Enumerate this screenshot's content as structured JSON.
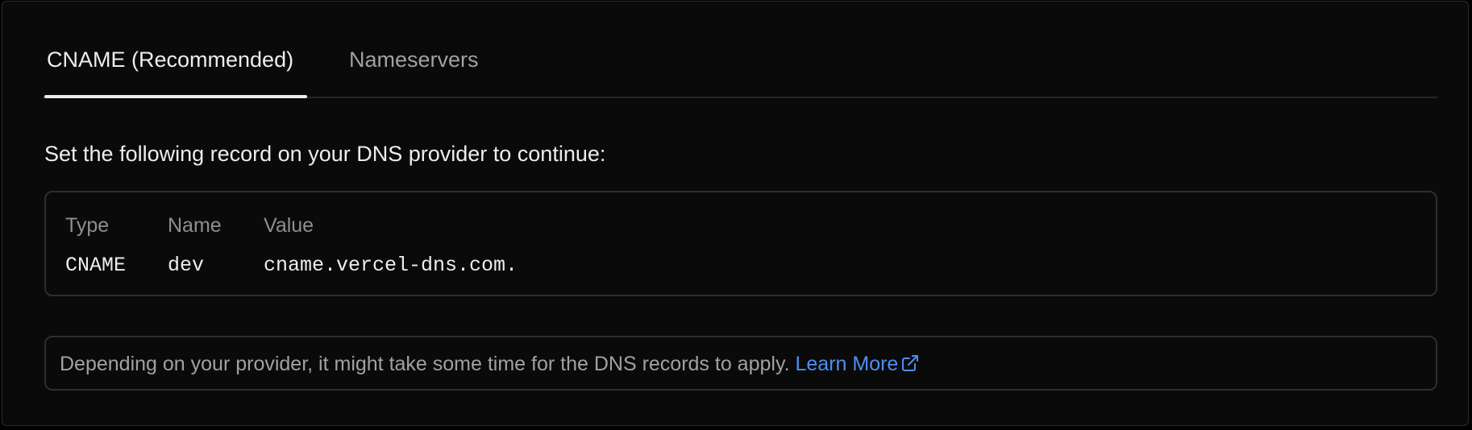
{
  "tabs": [
    {
      "label": "CNAME (Recommended)",
      "active": true
    },
    {
      "label": "Nameservers",
      "active": false
    }
  ],
  "instruction": "Set the following record on your DNS provider to continue:",
  "record": {
    "headers": {
      "type": "Type",
      "name": "Name",
      "value": "Value"
    },
    "row": {
      "type": "CNAME",
      "name": "dev",
      "value": "cname.vercel-dns.com."
    }
  },
  "note": {
    "text": "Depending on your provider, it might take some time for the DNS records to apply. ",
    "link_label": "Learn More",
    "link_icon": "external-link-icon"
  },
  "colors": {
    "background": "#0a0a0a",
    "text": "#ededed",
    "muted": "#a1a1a1",
    "link": "#4d90ef",
    "border": "#2e2e2e"
  }
}
